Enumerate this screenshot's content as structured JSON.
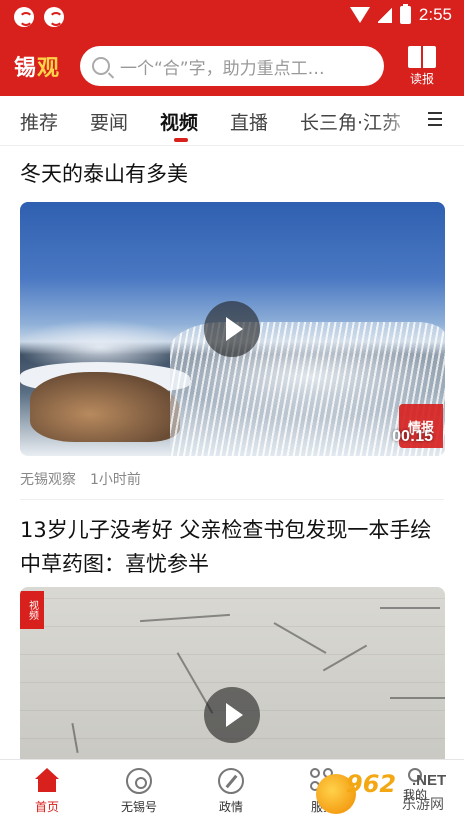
{
  "status_bar": {
    "time": "2:55"
  },
  "header": {
    "logo_part1": "锡",
    "logo_part2": "观",
    "search_placeholder": "一个“合”字，助力重点工…",
    "reader_label": "读报"
  },
  "tabs": [
    {
      "label": "推荐",
      "active": false
    },
    {
      "label": "要闻",
      "active": false
    },
    {
      "label": "视频",
      "active": true
    },
    {
      "label": "直播",
      "active": false
    },
    {
      "label": "长三角·江苏",
      "active": false
    }
  ],
  "feed": [
    {
      "title": "冬天的泰山有多美",
      "duration": "00:15",
      "badge": "情报",
      "source": "无锡观察",
      "time": "1小时前"
    },
    {
      "title": "13岁儿子没考好 父亲检查书包发现一本手绘中草药图：喜忧参半",
      "badge": "视频"
    }
  ],
  "bottom_nav": [
    {
      "label": "首页",
      "icon": "home-icon",
      "active": true
    },
    {
      "label": "无锡号",
      "icon": "wuxi-icon",
      "active": false
    },
    {
      "label": "政情",
      "icon": "compass-icon",
      "active": false
    },
    {
      "label": "服务",
      "icon": "service-icon",
      "active": false
    },
    {
      "label": "我的",
      "icon": "user-icon",
      "active": false
    }
  ],
  "watermark": {
    "number": "962",
    "net": ".NET",
    "cn": "乐游网"
  },
  "colors": {
    "brand_red": "#d8201d",
    "accent_yellow": "#ffd24a"
  }
}
